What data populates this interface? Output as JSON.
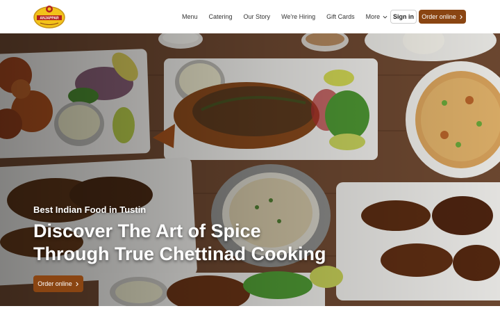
{
  "brand": {
    "logo_text": "ANJAPPAR",
    "icon": "anjappar-logo"
  },
  "nav": {
    "items": [
      {
        "label": "Menu"
      },
      {
        "label": "Catering"
      },
      {
        "label": "Our Story"
      },
      {
        "label": "We're Hiring"
      },
      {
        "label": "Gift Cards"
      },
      {
        "label": "More",
        "icon": "chevron-down-icon"
      }
    ],
    "sign_in": "Sign in",
    "order_online": "Order online"
  },
  "hero": {
    "eyebrow": "Best Indian Food in Tustin",
    "headline_line1": "Discover The Art of Spice",
    "headline_line2": "Through True Chettinad Cooking",
    "cta": "Order online"
  },
  "colors": {
    "accent": "#8a4512",
    "table_wood": "#6a4630",
    "text_light": "#ffffff"
  }
}
